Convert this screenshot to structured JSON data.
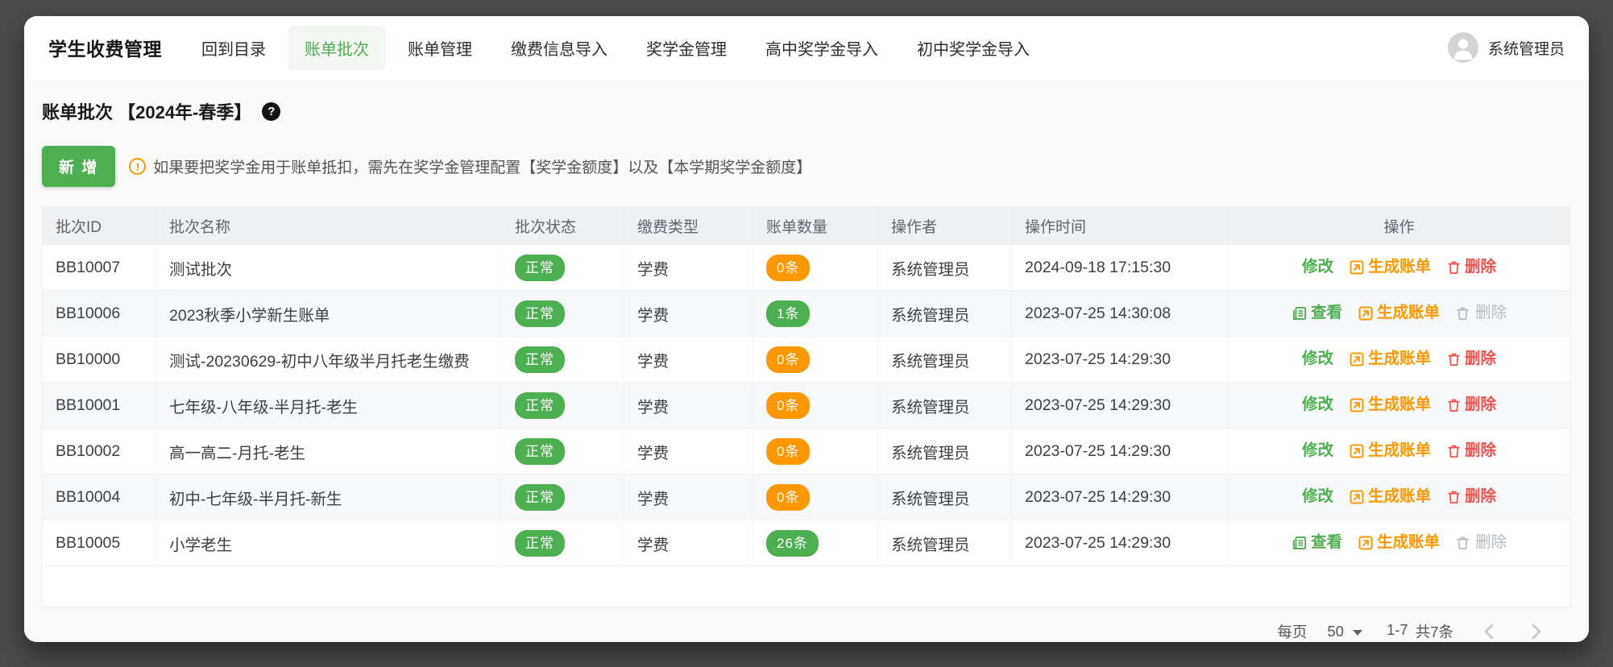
{
  "nav": {
    "brand": "学生收费管理",
    "items": [
      {
        "label": "回到目录",
        "active": false
      },
      {
        "label": "账单批次",
        "active": true
      },
      {
        "label": "账单管理",
        "active": false
      },
      {
        "label": "缴费信息导入",
        "active": false
      },
      {
        "label": "奖学金管理",
        "active": false
      },
      {
        "label": "高中奖学金导入",
        "active": false
      },
      {
        "label": "初中奖学金导入",
        "active": false
      }
    ],
    "user": {
      "name": "系统管理员"
    }
  },
  "page": {
    "title": "账单批次 【2024年-春季】",
    "help_glyph": "?",
    "add_button_label": "新 增",
    "notice_glyph": "!",
    "notice": "如果要把奖学金用于账单抵扣，需先在奖学金管理配置【奖学金额度】以及【本学期奖学金额度】"
  },
  "table": {
    "columns": [
      "批次ID",
      "批次名称",
      "批次状态",
      "缴费类型",
      "账单数量",
      "操作者",
      "操作时间",
      "操作"
    ],
    "rows": [
      {
        "id": "BB10007",
        "name": "测试批次",
        "status": "正常",
        "pay_type": "学费",
        "count": "0条",
        "count_color": "orange",
        "operator": "系统管理员",
        "time": "2024-09-18 17:15:30",
        "actions": [
          {
            "label": "修改",
            "style": "green",
            "icon": null,
            "disabled": false
          },
          {
            "label": "生成账单",
            "style": "orange",
            "icon": "generate",
            "disabled": false
          },
          {
            "label": "删除",
            "style": "red",
            "icon": "trash",
            "disabled": false
          }
        ]
      },
      {
        "id": "BB10006",
        "name": "2023秋季小学新生账单",
        "status": "正常",
        "pay_type": "学费",
        "count": "1条",
        "count_color": "green",
        "operator": "系统管理员",
        "time": "2023-07-25 14:30:08",
        "actions": [
          {
            "label": "查看",
            "style": "green",
            "icon": "view",
            "disabled": false
          },
          {
            "label": "生成账单",
            "style": "orange",
            "icon": "generate",
            "disabled": false
          },
          {
            "label": "删除",
            "style": "disabled",
            "icon": "trash",
            "disabled": true
          }
        ]
      },
      {
        "id": "BB10000",
        "name": "测试-20230629-初中八年级半月托老生缴费",
        "status": "正常",
        "pay_type": "学费",
        "count": "0条",
        "count_color": "orange",
        "operator": "系统管理员",
        "time": "2023-07-25 14:29:30",
        "actions": [
          {
            "label": "修改",
            "style": "green",
            "icon": null,
            "disabled": false
          },
          {
            "label": "生成账单",
            "style": "orange",
            "icon": "generate",
            "disabled": false
          },
          {
            "label": "删除",
            "style": "red",
            "icon": "trash",
            "disabled": false
          }
        ]
      },
      {
        "id": "BB10001",
        "name": "七年级-八年级-半月托-老生",
        "status": "正常",
        "pay_type": "学费",
        "count": "0条",
        "count_color": "orange",
        "operator": "系统管理员",
        "time": "2023-07-25 14:29:30",
        "actions": [
          {
            "label": "修改",
            "style": "green",
            "icon": null,
            "disabled": false
          },
          {
            "label": "生成账单",
            "style": "orange",
            "icon": "generate",
            "disabled": false
          },
          {
            "label": "删除",
            "style": "red",
            "icon": "trash",
            "disabled": false
          }
        ]
      },
      {
        "id": "BB10002",
        "name": "高一高二-月托-老生",
        "status": "正常",
        "pay_type": "学费",
        "count": "0条",
        "count_color": "orange",
        "operator": "系统管理员",
        "time": "2023-07-25 14:29:30",
        "actions": [
          {
            "label": "修改",
            "style": "green",
            "icon": null,
            "disabled": false
          },
          {
            "label": "生成账单",
            "style": "orange",
            "icon": "generate",
            "disabled": false
          },
          {
            "label": "删除",
            "style": "red",
            "icon": "trash",
            "disabled": false
          }
        ]
      },
      {
        "id": "BB10004",
        "name": "初中-七年级-半月托-新生",
        "status": "正常",
        "pay_type": "学费",
        "count": "0条",
        "count_color": "orange",
        "operator": "系统管理员",
        "time": "2023-07-25 14:29:30",
        "actions": [
          {
            "label": "修改",
            "style": "green",
            "icon": null,
            "disabled": false
          },
          {
            "label": "生成账单",
            "style": "orange",
            "icon": "generate",
            "disabled": false
          },
          {
            "label": "删除",
            "style": "red",
            "icon": "trash",
            "disabled": false
          }
        ]
      },
      {
        "id": "BB10005",
        "name": "小学老生",
        "status": "正常",
        "pay_type": "学费",
        "count": "26条",
        "count_color": "green",
        "operator": "系统管理员",
        "time": "2023-07-25 14:29:30",
        "actions": [
          {
            "label": "查看",
            "style": "green",
            "icon": "view",
            "disabled": false
          },
          {
            "label": "生成账单",
            "style": "orange",
            "icon": "generate",
            "disabled": false
          },
          {
            "label": "删除",
            "style": "disabled",
            "icon": "trash",
            "disabled": true
          }
        ]
      }
    ]
  },
  "pagination": {
    "per_page_label": "每页",
    "per_page_value": "50",
    "range": "1-7",
    "total": "共7条"
  },
  "colors": {
    "green": "#4caf50",
    "orange": "#ff9800",
    "red": "#ef5350",
    "disabled": "#b6bbc0",
    "frame_background": "#4a4a4a",
    "table_header_background": "#eef0f1",
    "stripe_row_background": "#f7f8f9"
  }
}
